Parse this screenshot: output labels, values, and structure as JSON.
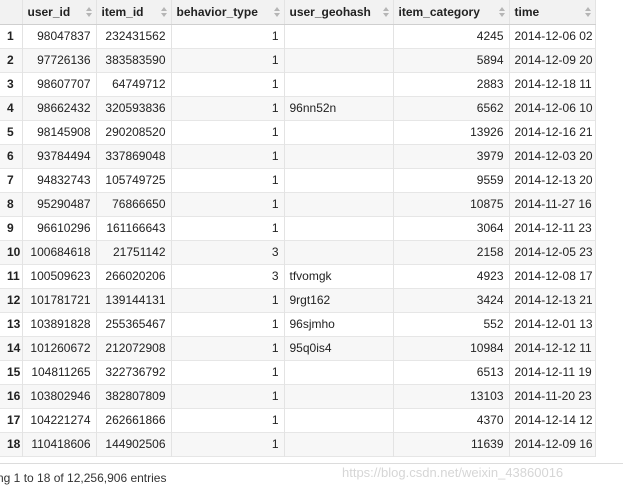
{
  "columns": [
    "",
    "user_id",
    "item_id",
    "behavior_type",
    "user_geohash",
    "item_category",
    "time"
  ],
  "rows": [
    [
      "1",
      "98047837",
      "232431562",
      "1",
      "",
      "4245",
      "2014-12-06 02"
    ],
    [
      "2",
      "97726136",
      "383583590",
      "1",
      "",
      "5894",
      "2014-12-09 20"
    ],
    [
      "3",
      "98607707",
      "64749712",
      "1",
      "",
      "2883",
      "2014-12-18 11"
    ],
    [
      "4",
      "98662432",
      "320593836",
      "1",
      "96nn52n",
      "6562",
      "2014-12-06 10"
    ],
    [
      "5",
      "98145908",
      "290208520",
      "1",
      "",
      "13926",
      "2014-12-16 21"
    ],
    [
      "6",
      "93784494",
      "337869048",
      "1",
      "",
      "3979",
      "2014-12-03 20"
    ],
    [
      "7",
      "94832743",
      "105749725",
      "1",
      "",
      "9559",
      "2014-12-13 20"
    ],
    [
      "8",
      "95290487",
      "76866650",
      "1",
      "",
      "10875",
      "2014-11-27 16"
    ],
    [
      "9",
      "96610296",
      "161166643",
      "1",
      "",
      "3064",
      "2014-12-11 23"
    ],
    [
      "10",
      "100684618",
      "21751142",
      "3",
      "",
      "2158",
      "2014-12-05 23"
    ],
    [
      "11",
      "100509623",
      "266020206",
      "3",
      "tfvomgk",
      "4923",
      "2014-12-08 17"
    ],
    [
      "12",
      "101781721",
      "139144131",
      "1",
      "9rgt162",
      "3424",
      "2014-12-13 21"
    ],
    [
      "13",
      "103891828",
      "255365467",
      "1",
      "96sjmho",
      "552",
      "2014-12-01 13"
    ],
    [
      "14",
      "101260672",
      "212072908",
      "1",
      "95q0is4",
      "10984",
      "2014-12-12 11"
    ],
    [
      "15",
      "104811265",
      "322736792",
      "1",
      "",
      "6513",
      "2014-12-11 19"
    ],
    [
      "16",
      "103802946",
      "382807809",
      "1",
      "",
      "13103",
      "2014-11-20 23"
    ],
    [
      "17",
      "104221274",
      "262661866",
      "1",
      "",
      "4370",
      "2014-12-14 12"
    ],
    [
      "18",
      "110418606",
      "144902506",
      "1",
      "",
      "11639",
      "2014-12-09 16"
    ]
  ],
  "footer": {
    "entries_text": "ng 1 to 18 of 12,256,906 entries"
  },
  "watermark": "https://blog.csdn.net/weixin_43860016"
}
